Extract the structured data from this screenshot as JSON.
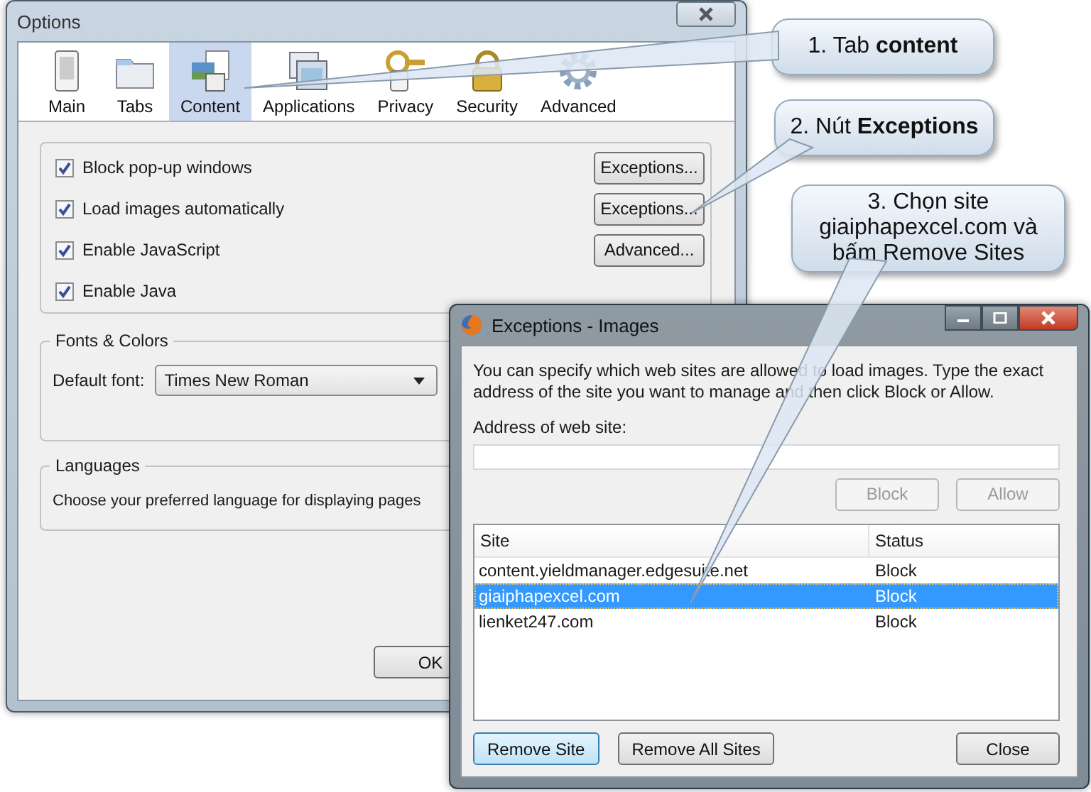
{
  "options_window": {
    "title": "Options",
    "tabs": [
      {
        "label": "Main",
        "selected": false
      },
      {
        "label": "Tabs",
        "selected": false
      },
      {
        "label": "Content",
        "selected": true
      },
      {
        "label": "Applications",
        "selected": false
      },
      {
        "label": "Privacy",
        "selected": false
      },
      {
        "label": "Security",
        "selected": false
      },
      {
        "label": "Advanced",
        "selected": false
      }
    ],
    "content_options": [
      {
        "label": "Block pop-up windows",
        "checked": true,
        "button": "Exceptions..."
      },
      {
        "label": "Load images automatically",
        "checked": true,
        "button": "Exceptions..."
      },
      {
        "label": "Enable JavaScript",
        "checked": true,
        "button": "Advanced..."
      },
      {
        "label": "Enable Java",
        "checked": true
      }
    ],
    "fonts_colors": {
      "title": "Fonts & Colors",
      "default_font_label": "Default font:",
      "default_font": "Times New Roman"
    },
    "languages": {
      "title": "Languages",
      "text": "Choose your preferred language for displaying pages"
    },
    "buttons": [
      "OK"
    ]
  },
  "exceptions_window": {
    "title": "Exceptions - Images",
    "description": "You can specify which web sites are allowed to load images. Type the exact address of the site you want to manage and then click Block or Allow.",
    "address_label": "Address of web site:",
    "action_buttons": [
      {
        "label": "Block",
        "disabled": true
      },
      {
        "label": "Allow",
        "disabled": true
      }
    ],
    "table": {
      "columns": [
        "Site",
        "Status"
      ],
      "rows": [
        {
          "site": "content.yieldmanager.edgesuite.net",
          "status": "Block",
          "selected": false
        },
        {
          "site": "giaiphapexcel.com",
          "status": "Block",
          "selected": true
        },
        {
          "site": "lienket247.com",
          "status": "Block",
          "selected": false
        }
      ]
    },
    "buttons": [
      {
        "label": "Remove Site",
        "focused": true
      },
      {
        "label": "Remove All Sites",
        "focused": false
      },
      {
        "label": "Close",
        "focused": false
      }
    ]
  },
  "callouts": [
    {
      "text": "1. Tab **content**"
    },
    {
      "text": "2. Nút **Exceptions**"
    },
    {
      "text": "3. Chọn site giaiphapexcel.com và bấm Remove Sites"
    }
  ]
}
